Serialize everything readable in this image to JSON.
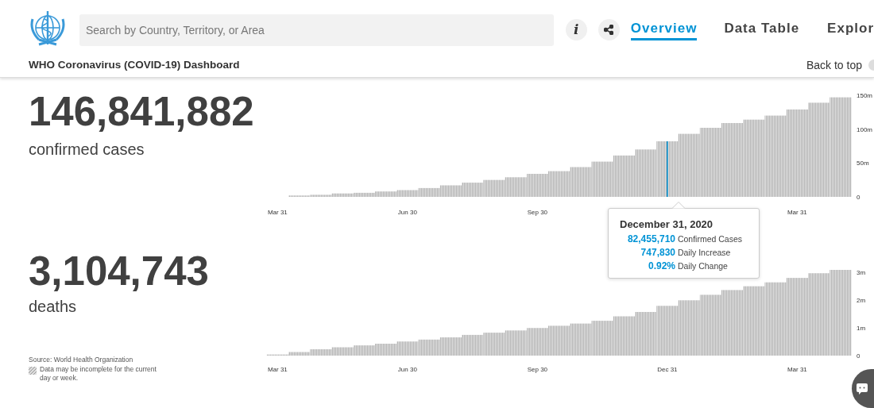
{
  "header": {
    "search": {
      "placeholder": "Search by Country, Territory, or Area"
    },
    "info_button": {
      "label": "i"
    },
    "tabs": [
      {
        "label": "Overview",
        "selected": true
      },
      {
        "label": "Data Table",
        "selected": false
      },
      {
        "label": "Explor",
        "selected": false
      }
    ],
    "title": "WHO Coronavirus (COVID-19) Dashboard",
    "back_to_top": "Back to top"
  },
  "panels": [
    {
      "total": "146,841,882",
      "label": "confirmed cases",
      "chart_data": {
        "type": "bar",
        "categories": [
          null,
          null,
          null,
          "Mar 31",
          null,
          null,
          null,
          null,
          null,
          "Jun 30",
          null,
          null,
          null,
          null,
          null,
          "Sep 30",
          null,
          null,
          null,
          null,
          null,
          null,
          null,
          null,
          null,
          null,
          null,
          "Mar 31",
          null,
          null
        ],
        "series": [
          {
            "color": "#b4b4b4",
            "values": [
              null,
              null,
              null,
              null,
              2,
              3,
              5,
              6,
              8,
              10,
              13,
              17,
              21,
              25,
              29,
              34,
              38,
              44,
              52,
              61,
              70,
              82,
              93,
              102,
              109,
              114,
              120,
              129,
              139,
              147
            ]
          },
          {
            "color": "#0093d5",
            "values": [
              null,
              null,
              null,
              null,
              null,
              null,
              null,
              null,
              null,
              null,
              null,
              null,
              null,
              null,
              null,
              null,
              null,
              null,
              null,
              null,
              null,
              82,
              null,
              null,
              null,
              null,
              null,
              null,
              null,
              null
            ]
          }
        ],
        "yticks": [
          {
            "value": 0,
            "label": "0"
          },
          {
            "value": 50,
            "label": "50m"
          },
          {
            "value": 100,
            "label": "100m"
          },
          {
            "value": 150,
            "label": "150m"
          }
        ],
        "ylim": [
          0,
          150
        ]
      }
    },
    {
      "total": "3,104,743",
      "label": "deaths",
      "chart_data": {
        "type": "bar",
        "categories": [
          null,
          null,
          null,
          "Mar 31",
          null,
          null,
          null,
          null,
          null,
          "Jun 30",
          null,
          null,
          null,
          null,
          null,
          "Sep 30",
          null,
          null,
          null,
          null,
          null,
          "Dec 31",
          null,
          null,
          null,
          null,
          null,
          "Mar 31",
          null,
          null
        ],
        "values": [
          null,
          null,
          null,
          0.04,
          0.13,
          0.23,
          0.3,
          0.37,
          0.43,
          0.51,
          0.58,
          0.66,
          0.75,
          0.83,
          0.91,
          1.0,
          1.08,
          1.16,
          1.26,
          1.42,
          1.58,
          1.8,
          2.0,
          2.2,
          2.37,
          2.51,
          2.65,
          2.81,
          2.98,
          3.1
        ],
        "yticks": [
          {
            "value": 0,
            "label": "0"
          },
          {
            "value": 1,
            "label": "1m"
          },
          {
            "value": 2,
            "label": "2m"
          },
          {
            "value": 3,
            "label": "3m"
          }
        ],
        "ylim": [
          0,
          3.1
        ]
      }
    }
  ],
  "tooltip": {
    "title": "December 31, 2020",
    "rows": [
      "**82,455,710** Confirmed Cases",
      "**747,830** Daily Increase",
      "**0.92%** Daily Change"
    ]
  },
  "source": "Source:  World Health Organization",
  "legend_note": "Data may be incomplete for the current day or week."
}
